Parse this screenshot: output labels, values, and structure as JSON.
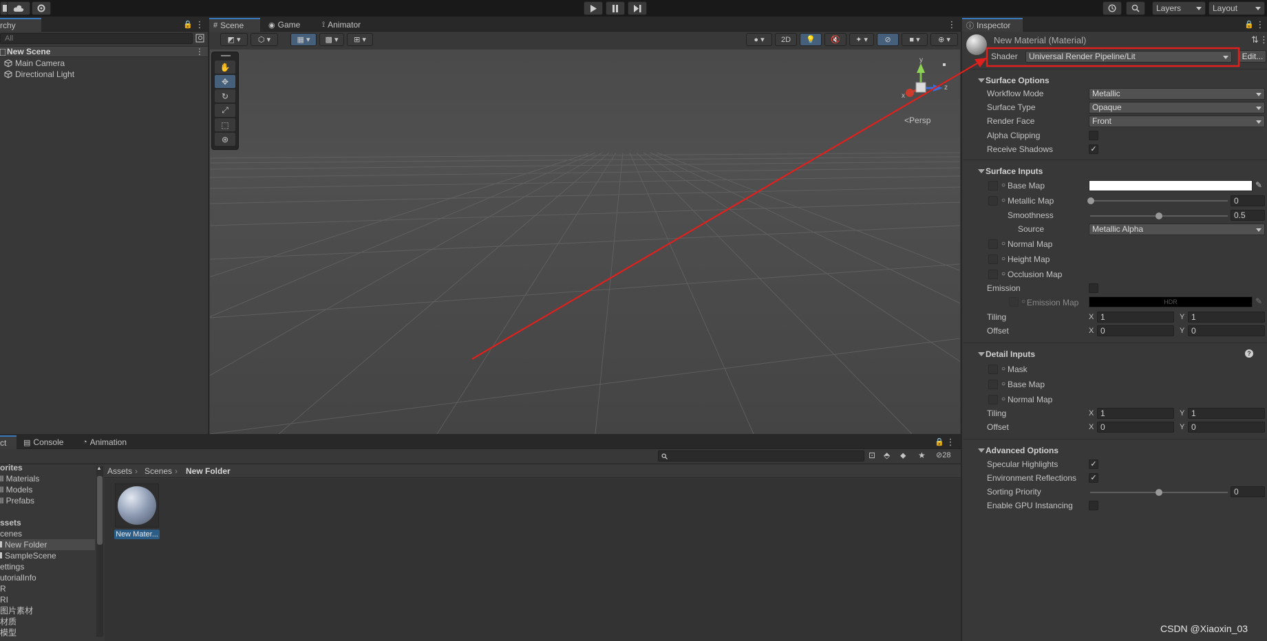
{
  "toolbar": {
    "layers_label": "Layers",
    "layout_label": "Layout"
  },
  "hierarchy": {
    "tab_label": "rchy",
    "search_placeholder": "All",
    "scene_name": "New Scene",
    "items": [
      {
        "label": "Main Camera"
      },
      {
        "label": "Directional Light"
      }
    ]
  },
  "scene_tabs": [
    {
      "label": "Scene",
      "icon": "scene-icon"
    },
    {
      "label": "Game",
      "icon": "game-icon"
    },
    {
      "label": "Animator",
      "icon": "animator-icon"
    }
  ],
  "scene_toolbar": {
    "mode_2d": "2D"
  },
  "gizmo": {
    "axis_x": "x",
    "axis_y": "y",
    "axis_z": "z",
    "projection_label": "Persp"
  },
  "inspector": {
    "tab_label": "Inspector",
    "title": "New Material (Material)",
    "shader_label": "Shader",
    "shader_value": "Universal Render Pipeline/Lit",
    "edit_label": "Edit...",
    "surface_options": {
      "header": "Surface Options",
      "rows": [
        {
          "label": "Workflow Mode",
          "value": "Metallic"
        },
        {
          "label": "Surface Type",
          "value": "Opaque"
        },
        {
          "label": "Render Face",
          "value": "Front"
        }
      ],
      "alpha_clipping_label": "Alpha Clipping",
      "alpha_clipping": false,
      "receive_shadows_label": "Receive Shadows",
      "receive_shadows": true
    },
    "surface_inputs": {
      "header": "Surface Inputs",
      "base_map_label": "Base Map",
      "metallic_map_label": "Metallic Map",
      "metallic_value": "0",
      "smoothness_label": "Smoothness",
      "smoothness_value": "0.5",
      "source_label": "Source",
      "source_value": "Metallic Alpha",
      "normal_map_label": "Normal Map",
      "height_map_label": "Height Map",
      "occlusion_map_label": "Occlusion Map",
      "emission_label": "Emission",
      "emission_map_label": "Emission Map",
      "hdr_label": "HDR",
      "tiling_label": "Tiling",
      "offset_label": "Offset",
      "x_label": "X",
      "y_label": "Y",
      "tiling_x": "1",
      "tiling_y": "1",
      "offset_x": "0",
      "offset_y": "0"
    },
    "detail_inputs": {
      "header": "Detail Inputs",
      "mask_label": "Mask",
      "base_map_label": "Base Map",
      "normal_map_label": "Normal Map",
      "tiling_label": "Tiling",
      "offset_label": "Offset",
      "tiling_x": "1",
      "tiling_y": "1",
      "offset_x": "0",
      "offset_y": "0"
    },
    "advanced_options": {
      "header": "Advanced Options",
      "specular_label": "Specular Highlights",
      "specular": true,
      "env_reflections_label": "Environment Reflections",
      "env_reflections": true,
      "sorting_priority_label": "Sorting Priority",
      "sorting_priority_value": "0",
      "gpu_instancing_label": "Enable GPU Instancing",
      "gpu_instancing": false
    }
  },
  "project": {
    "tabs": [
      {
        "label": "ct"
      },
      {
        "label": "Console",
        "icon": "console-icon"
      },
      {
        "label": "Animation",
        "icon": "animation-icon"
      }
    ],
    "hidden_count": "28",
    "tree": [
      {
        "label": "orites",
        "bold": true
      },
      {
        "label": "ll Materials"
      },
      {
        "label": "ll Models"
      },
      {
        "label": "ll Prefabs"
      },
      {
        "label": "ssets",
        "bold": true
      },
      {
        "label": "cenes"
      },
      {
        "label": "New Folder",
        "selected": true
      },
      {
        "label": "SampleScene"
      },
      {
        "label": "ettings"
      },
      {
        "label": "utorialInfo"
      },
      {
        "label": "R"
      },
      {
        "label": "RI"
      },
      {
        "label": "图片素材"
      },
      {
        "label": "材质"
      },
      {
        "label": "模型"
      }
    ],
    "breadcrumb": [
      "Assets",
      "Scenes",
      "New Folder"
    ],
    "asset_label": "New Mater..."
  },
  "watermark": "CSDN @Xiaoxin_03",
  "colors": {
    "accent": "#3a79bb",
    "annotation_red": "#e0201c",
    "panel": "#383838",
    "scene_bg": "#4a4a4a"
  }
}
